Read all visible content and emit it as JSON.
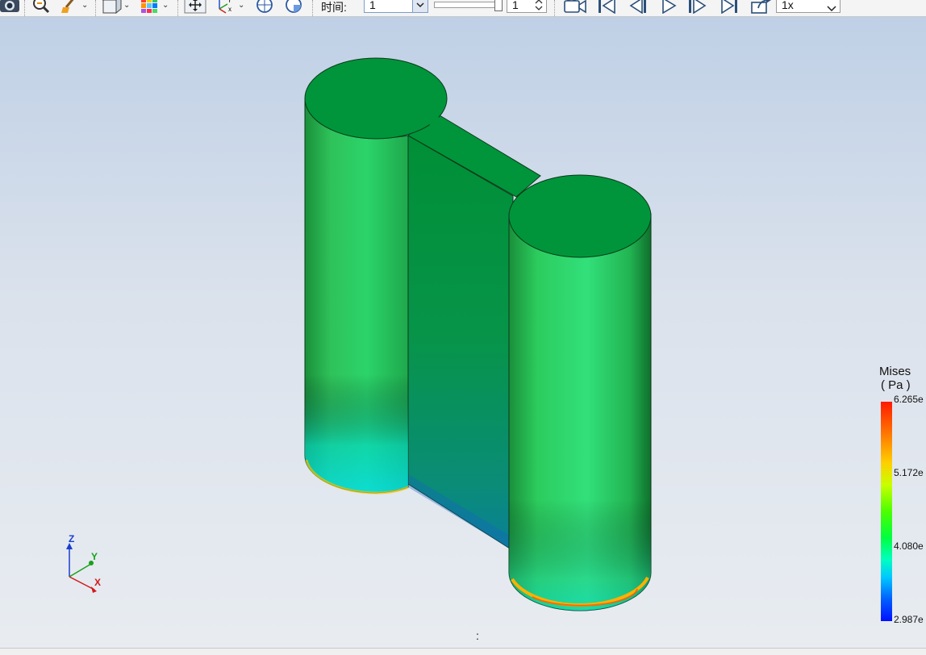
{
  "toolbar": {
    "time_label": "时间:",
    "time_value": "1",
    "frame_value": "1",
    "speed_value": "1x"
  },
  "legend": {
    "title": "Mises",
    "unit": "( Pa )",
    "ticks": [
      "6.265e",
      "5.172e",
      "4.080e",
      "2.987e"
    ]
  },
  "axes": {
    "z": "Z",
    "y": "Y",
    "x": "X"
  },
  "status": {
    "text": ":"
  },
  "colors": {
    "model_face": "#00953a",
    "model_side": "#22c05a",
    "background_top": "#bfd0e6",
    "background_bottom": "#e8ecf1"
  }
}
